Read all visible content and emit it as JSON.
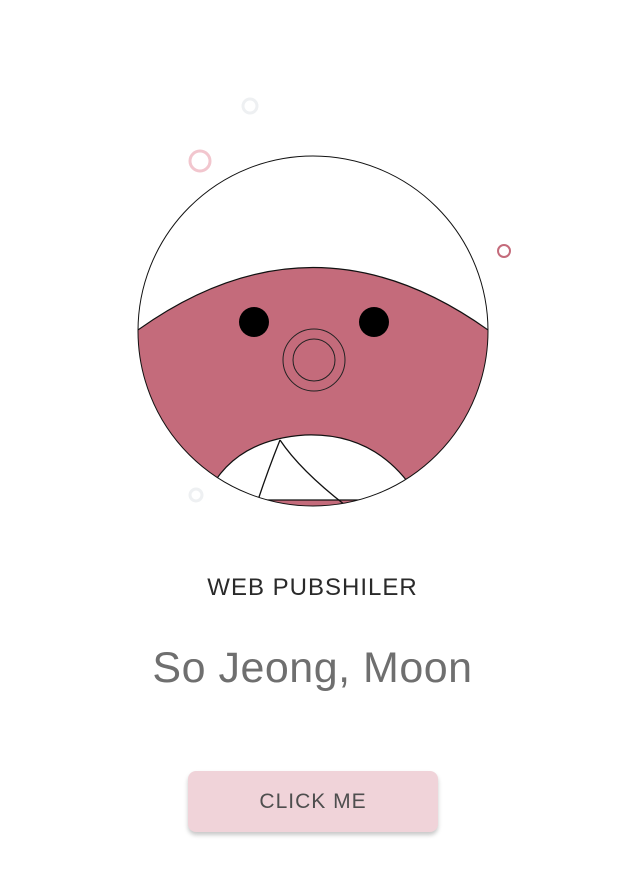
{
  "profile": {
    "role": "WEB PUBSHILER",
    "name": "So Jeong, Moon"
  },
  "actions": {
    "button_label": "CLICK ME"
  },
  "colors": {
    "face": "#c46b7b",
    "button": "#f0d3d9",
    "bubble_pink": "#f2c6ce",
    "bubble_rose": "#c46b7b",
    "bubble_light": "#eef0f2"
  }
}
